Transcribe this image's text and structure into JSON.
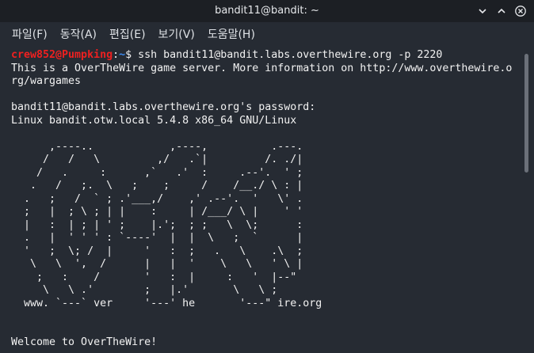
{
  "window": {
    "title": "bandit11@bandit: ~"
  },
  "menu": [
    {
      "label": "파일(F)"
    },
    {
      "label": "동작(A)"
    },
    {
      "label": "편집(E)"
    },
    {
      "label": "보기(V)"
    },
    {
      "label": "도움말(H)"
    }
  ],
  "terminal": {
    "prompt_user": "crew852@Pumpking",
    "prompt_colon": ":",
    "prompt_path": "~",
    "prompt_dollar": "$",
    "command": " ssh bandit11@bandit.labs.overthewire.org -p 2220",
    "output_lines": [
      "This is a OverTheWire game server. More information on http://www.overthewire.o",
      "rg/wargames",
      "",
      "bandit11@bandit.labs.overthewire.org's password:",
      "Linux bandit.otw.local 5.4.8 x86_64 GNU/Linux",
      "",
      "      ,----..            ,----,          .---.",
      "     /   /   \\         ,/   .`|         /. ./|",
      "    /   .     :      ,`   .'  :     .--'.  ' ;",
      "   .   /   ;.  \\   ;    ;     /    /__./ \\ : |",
      "  .   ;   /  ` ; .'___,/    ,' .--'.  '   \\' .",
      "  ;   |  ; \\ ; | |    :     | /___/ \\ |    ' '",
      "  |   :  | ; | ' ;    |.';  ; ;   \\  \\;      :",
      "  .   |  ' ' ' : `----'  |  |  \\   ;  `      |",
      "  '   ;  \\; /  |     '   :  ;   .   \\    .\\  ;",
      "   \\   \\  ',  /      |   |  '    \\   \\   ' \\ |",
      "    ;   :    /       '   :  |     :   '  |--\"",
      "     \\   \\ .'        ;   |.'       \\   \\ ;",
      "  www. `---` ver     '---' he       '---\" ire.org",
      "",
      "",
      "Welcome to OverTheWire!"
    ]
  },
  "icons": {
    "minimize": "minimize-icon",
    "maximize": "maximize-icon",
    "close": "close-icon"
  },
  "colors": {
    "prompt_user": "#ee2020",
    "prompt_path": "#3d8bf2",
    "background": "#262b33"
  }
}
